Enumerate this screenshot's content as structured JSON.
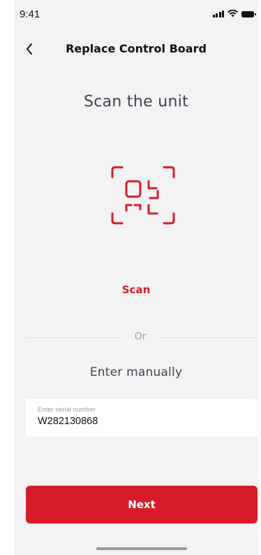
{
  "status_bar": {
    "time": "9:41"
  },
  "nav": {
    "title": "Replace Control Board",
    "back_icon": "chevron-left-icon"
  },
  "main": {
    "headline": "Scan the unit",
    "scan_icon": "qr-scan-icon",
    "scan_label": "Scan",
    "divider_text": "Or",
    "manual_title": "Enter manually"
  },
  "serial_field": {
    "label": "Enter serial number",
    "value": "W282130868"
  },
  "footer": {
    "next_label": "Next"
  },
  "colors": {
    "accent": "#d81b2a",
    "background": "#f3f3f3",
    "heading": "#3b4654",
    "muted": "#9aa0a6"
  }
}
